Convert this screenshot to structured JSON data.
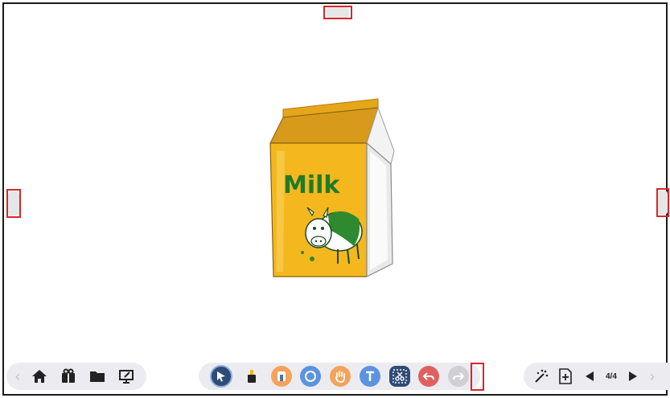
{
  "toolbar_right": {
    "page_indicator": "4/4"
  },
  "canvas": {
    "carton_text": "Milk"
  },
  "icons": {
    "left": [
      "chevron-left-icon",
      "home-icon",
      "gift-box-icon",
      "folder-icon",
      "screen-annotate-icon"
    ],
    "middle": [
      "select-arrow-icon",
      "pen-icon",
      "eraser-icon",
      "shape-circle-icon",
      "hand-icon",
      "text-icon",
      "scissors-select-icon",
      "undo-icon",
      "redo-icon"
    ],
    "right": [
      "magic-clear-icon",
      "add-page-icon",
      "previous-page-icon",
      "next-page-icon",
      "chevron-right-icon"
    ]
  },
  "colors": {
    "toolbar_bg": "#ececf0",
    "active_tool": "#2f4b78",
    "tool_orange": "#f5a35a",
    "tool_blue": "#5b93df",
    "tool_red": "#e06060",
    "milk_yellow": "#f4b81e",
    "milk_green": "#1f7a2a",
    "highlight_red": "#d9262b"
  }
}
